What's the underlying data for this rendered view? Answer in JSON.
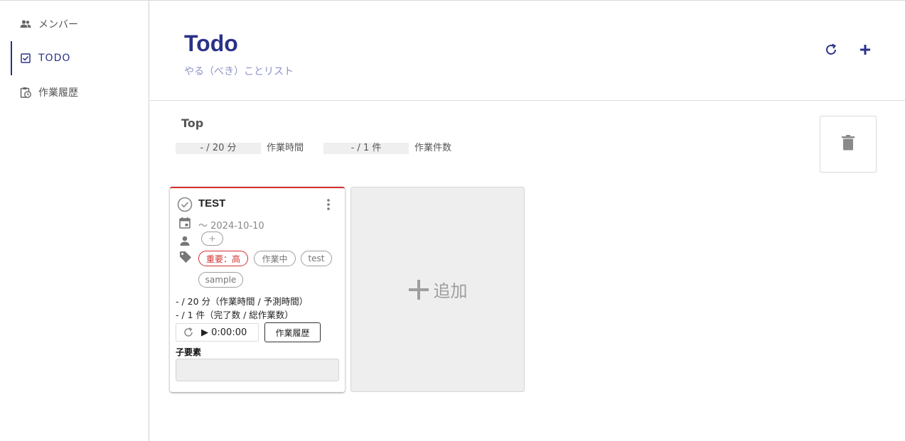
{
  "sidebar": {
    "items": [
      {
        "label": "メンバー",
        "icon": "group-icon",
        "active": false
      },
      {
        "label": "TODO",
        "icon": "checkbox-icon",
        "active": true
      },
      {
        "label": "作業履歴",
        "icon": "clipboard-clock-icon",
        "active": false
      }
    ]
  },
  "header": {
    "title": "Todo",
    "subtitle": "やる（べき）ことリスト",
    "refresh_icon": "refresh-icon",
    "add_icon": "plus-icon"
  },
  "section": {
    "title": "Top",
    "work_time_value": "- / 20 分",
    "work_time_label": "作業時間",
    "work_count_value": "- / 1 件",
    "work_count_label": "作業件数",
    "delete_icon": "trash-icon"
  },
  "card": {
    "title": "TEST",
    "date": "～ 2024-10-10",
    "assignee_add": "+",
    "tags": [
      "重要：高",
      "作業中",
      "test",
      "sample"
    ],
    "time_line": "- / 20 分（作業時間 / 予測時間）",
    "count_line": "- / 1 件（完了数 / 総作業数）",
    "timer": "▶ 0:00:00",
    "history_button": "作業履歴",
    "children_label": "子要素"
  },
  "add_card": {
    "label": "追加"
  },
  "colors": {
    "accent": "#2a3289",
    "priority_high": "#d32f2f",
    "subtitle": "#8c93c8"
  }
}
